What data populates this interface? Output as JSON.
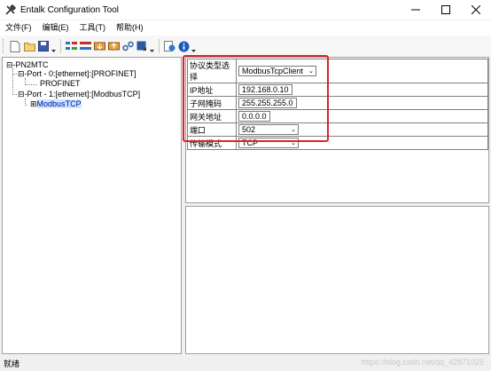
{
  "window": {
    "title": "Entalk Configuration Tool"
  },
  "menu": {
    "items": [
      "文件(F)",
      "编辑(E)",
      "工具(T)",
      "帮助(H)"
    ]
  },
  "toolbar": {
    "icons": [
      "new-file-icon",
      "open-folder-icon",
      "save-icon",
      "config-a-icon",
      "config-b-icon",
      "download-icon",
      "upload-icon",
      "link-icon",
      "export-icon",
      "monitor-icon",
      "info-icon"
    ]
  },
  "tree": {
    "root": "PN2MTC",
    "port0": "Port - 0:[ethernet]:[PROFINET]",
    "port0_child": "PROFINET",
    "port1": "Port - 1:[ethernet]:[ModbusTCP]",
    "port1_child": "ModbusTCP"
  },
  "properties": {
    "protocol_label": "协议类型选择",
    "protocol_value": "ModbusTcpClient",
    "ip_label": "IP地址",
    "ip_value": "192.168.0.10",
    "mask_label": "子网掩码",
    "mask_value": "255.255.255.0",
    "gateway_label": "网关地址",
    "gateway_value": "0.0.0.0",
    "port_label": "端口",
    "port_value": "502",
    "mode_label": "传输模式",
    "mode_value": "TCP"
  },
  "status": {
    "text": "就绪"
  },
  "watermark": "https://blog.csdn.net/qq_42871025",
  "colors": {
    "highlight": "#d9242a",
    "selection": "#cce8ff"
  }
}
